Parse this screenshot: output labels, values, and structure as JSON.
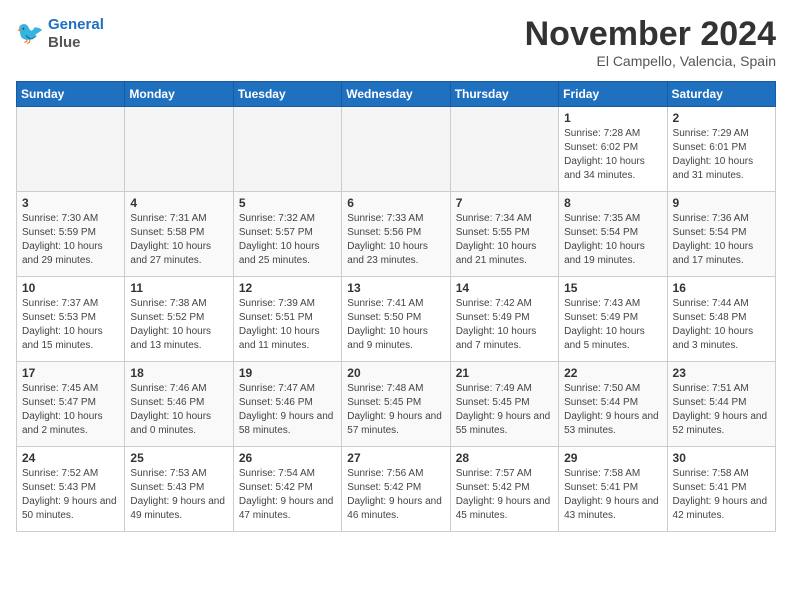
{
  "header": {
    "logo_line1": "General",
    "logo_line2": "Blue",
    "month": "November 2024",
    "location": "El Campello, Valencia, Spain"
  },
  "weekdays": [
    "Sunday",
    "Monday",
    "Tuesday",
    "Wednesday",
    "Thursday",
    "Friday",
    "Saturday"
  ],
  "weeks": [
    [
      {
        "day": "",
        "empty": true
      },
      {
        "day": "",
        "empty": true
      },
      {
        "day": "",
        "empty": true
      },
      {
        "day": "",
        "empty": true
      },
      {
        "day": "",
        "empty": true
      },
      {
        "day": "1",
        "sunrise": "Sunrise: 7:28 AM",
        "sunset": "Sunset: 6:02 PM",
        "daylight": "Daylight: 10 hours and 34 minutes."
      },
      {
        "day": "2",
        "sunrise": "Sunrise: 7:29 AM",
        "sunset": "Sunset: 6:01 PM",
        "daylight": "Daylight: 10 hours and 31 minutes."
      }
    ],
    [
      {
        "day": "3",
        "sunrise": "Sunrise: 7:30 AM",
        "sunset": "Sunset: 5:59 PM",
        "daylight": "Daylight: 10 hours and 29 minutes."
      },
      {
        "day": "4",
        "sunrise": "Sunrise: 7:31 AM",
        "sunset": "Sunset: 5:58 PM",
        "daylight": "Daylight: 10 hours and 27 minutes."
      },
      {
        "day": "5",
        "sunrise": "Sunrise: 7:32 AM",
        "sunset": "Sunset: 5:57 PM",
        "daylight": "Daylight: 10 hours and 25 minutes."
      },
      {
        "day": "6",
        "sunrise": "Sunrise: 7:33 AM",
        "sunset": "Sunset: 5:56 PM",
        "daylight": "Daylight: 10 hours and 23 minutes."
      },
      {
        "day": "7",
        "sunrise": "Sunrise: 7:34 AM",
        "sunset": "Sunset: 5:55 PM",
        "daylight": "Daylight: 10 hours and 21 minutes."
      },
      {
        "day": "8",
        "sunrise": "Sunrise: 7:35 AM",
        "sunset": "Sunset: 5:54 PM",
        "daylight": "Daylight: 10 hours and 19 minutes."
      },
      {
        "day": "9",
        "sunrise": "Sunrise: 7:36 AM",
        "sunset": "Sunset: 5:54 PM",
        "daylight": "Daylight: 10 hours and 17 minutes."
      }
    ],
    [
      {
        "day": "10",
        "sunrise": "Sunrise: 7:37 AM",
        "sunset": "Sunset: 5:53 PM",
        "daylight": "Daylight: 10 hours and 15 minutes."
      },
      {
        "day": "11",
        "sunrise": "Sunrise: 7:38 AM",
        "sunset": "Sunset: 5:52 PM",
        "daylight": "Daylight: 10 hours and 13 minutes."
      },
      {
        "day": "12",
        "sunrise": "Sunrise: 7:39 AM",
        "sunset": "Sunset: 5:51 PM",
        "daylight": "Daylight: 10 hours and 11 minutes."
      },
      {
        "day": "13",
        "sunrise": "Sunrise: 7:41 AM",
        "sunset": "Sunset: 5:50 PM",
        "daylight": "Daylight: 10 hours and 9 minutes."
      },
      {
        "day": "14",
        "sunrise": "Sunrise: 7:42 AM",
        "sunset": "Sunset: 5:49 PM",
        "daylight": "Daylight: 10 hours and 7 minutes."
      },
      {
        "day": "15",
        "sunrise": "Sunrise: 7:43 AM",
        "sunset": "Sunset: 5:49 PM",
        "daylight": "Daylight: 10 hours and 5 minutes."
      },
      {
        "day": "16",
        "sunrise": "Sunrise: 7:44 AM",
        "sunset": "Sunset: 5:48 PM",
        "daylight": "Daylight: 10 hours and 3 minutes."
      }
    ],
    [
      {
        "day": "17",
        "sunrise": "Sunrise: 7:45 AM",
        "sunset": "Sunset: 5:47 PM",
        "daylight": "Daylight: 10 hours and 2 minutes."
      },
      {
        "day": "18",
        "sunrise": "Sunrise: 7:46 AM",
        "sunset": "Sunset: 5:46 PM",
        "daylight": "Daylight: 10 hours and 0 minutes."
      },
      {
        "day": "19",
        "sunrise": "Sunrise: 7:47 AM",
        "sunset": "Sunset: 5:46 PM",
        "daylight": "Daylight: 9 hours and 58 minutes."
      },
      {
        "day": "20",
        "sunrise": "Sunrise: 7:48 AM",
        "sunset": "Sunset: 5:45 PM",
        "daylight": "Daylight: 9 hours and 57 minutes."
      },
      {
        "day": "21",
        "sunrise": "Sunrise: 7:49 AM",
        "sunset": "Sunset: 5:45 PM",
        "daylight": "Daylight: 9 hours and 55 minutes."
      },
      {
        "day": "22",
        "sunrise": "Sunrise: 7:50 AM",
        "sunset": "Sunset: 5:44 PM",
        "daylight": "Daylight: 9 hours and 53 minutes."
      },
      {
        "day": "23",
        "sunrise": "Sunrise: 7:51 AM",
        "sunset": "Sunset: 5:44 PM",
        "daylight": "Daylight: 9 hours and 52 minutes."
      }
    ],
    [
      {
        "day": "24",
        "sunrise": "Sunrise: 7:52 AM",
        "sunset": "Sunset: 5:43 PM",
        "daylight": "Daylight: 9 hours and 50 minutes."
      },
      {
        "day": "25",
        "sunrise": "Sunrise: 7:53 AM",
        "sunset": "Sunset: 5:43 PM",
        "daylight": "Daylight: 9 hours and 49 minutes."
      },
      {
        "day": "26",
        "sunrise": "Sunrise: 7:54 AM",
        "sunset": "Sunset: 5:42 PM",
        "daylight": "Daylight: 9 hours and 47 minutes."
      },
      {
        "day": "27",
        "sunrise": "Sunrise: 7:56 AM",
        "sunset": "Sunset: 5:42 PM",
        "daylight": "Daylight: 9 hours and 46 minutes."
      },
      {
        "day": "28",
        "sunrise": "Sunrise: 7:57 AM",
        "sunset": "Sunset: 5:42 PM",
        "daylight": "Daylight: 9 hours and 45 minutes."
      },
      {
        "day": "29",
        "sunrise": "Sunrise: 7:58 AM",
        "sunset": "Sunset: 5:41 PM",
        "daylight": "Daylight: 9 hours and 43 minutes."
      },
      {
        "day": "30",
        "sunrise": "Sunrise: 7:58 AM",
        "sunset": "Sunset: 5:41 PM",
        "daylight": "Daylight: 9 hours and 42 minutes."
      }
    ]
  ]
}
